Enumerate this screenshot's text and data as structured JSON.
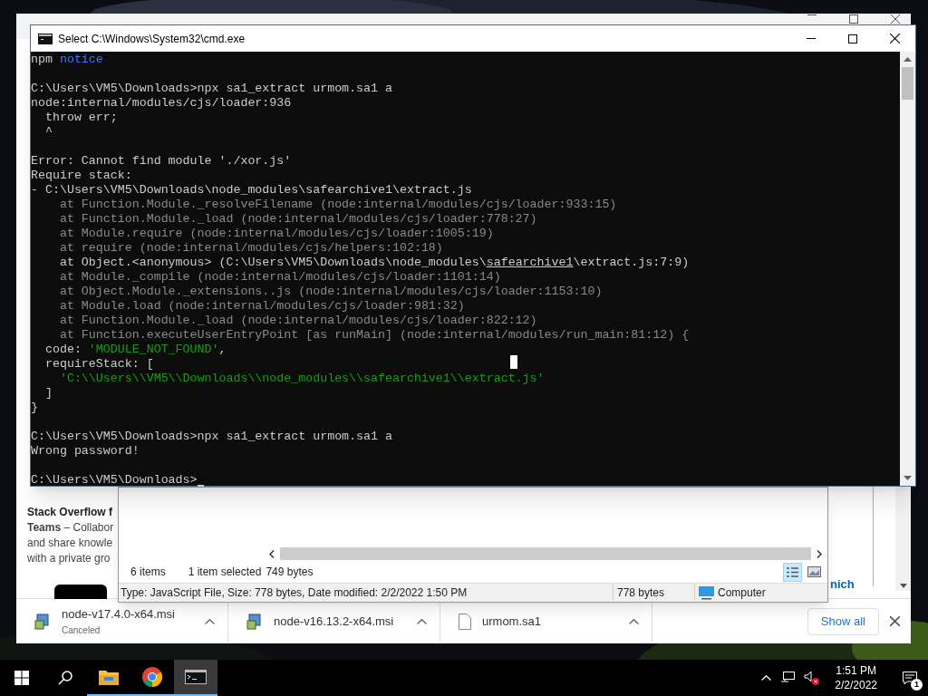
{
  "terminal": {
    "title": "Select C:\\Windows\\System32\\cmd.exe",
    "lines": [
      {
        "kind": "text",
        "segments": [
          {
            "text": "npm ",
            "kind": "plain"
          },
          {
            "text": "notice",
            "kind": "info"
          }
        ]
      },
      {
        "kind": "blank"
      },
      {
        "kind": "text",
        "segments": [
          {
            "text": "C:\\Users\\VM5\\Downloads>npx sa1_extract urmom.sa1 a",
            "kind": "plain"
          }
        ]
      },
      {
        "kind": "text",
        "segments": [
          {
            "text": "node:internal/modules/cjs/loader:936",
            "kind": "plain"
          }
        ]
      },
      {
        "kind": "text",
        "segments": [
          {
            "text": "  throw err;",
            "kind": "plain"
          }
        ]
      },
      {
        "kind": "text",
        "segments": [
          {
            "text": "  ^",
            "kind": "plain"
          }
        ]
      },
      {
        "kind": "blank"
      },
      {
        "kind": "text",
        "segments": [
          {
            "text": "Error: Cannot find module './xor.js'",
            "kind": "plain"
          }
        ]
      },
      {
        "kind": "text",
        "segments": [
          {
            "text": "Require stack:",
            "kind": "plain"
          }
        ]
      },
      {
        "kind": "text",
        "segments": [
          {
            "text": "- C:\\Users\\VM5\\Downloads\\node_modules\\safearchive1\\extract.js",
            "kind": "plain"
          }
        ]
      },
      {
        "kind": "text",
        "segments": [
          {
            "text": "    at Function.Module._resolveFilename (node:internal/modules/cjs/loader:933:15)",
            "kind": "dim"
          }
        ]
      },
      {
        "kind": "text",
        "segments": [
          {
            "text": "    at Function.Module._load (node:internal/modules/cjs/loader:778:27)",
            "kind": "dim"
          }
        ]
      },
      {
        "kind": "text",
        "segments": [
          {
            "text": "    at Module.require (node:internal/modules/cjs/loader:1005:19)",
            "kind": "dim"
          }
        ]
      },
      {
        "kind": "text",
        "segments": [
          {
            "text": "    at require (node:internal/modules/cjs/helpers:102:18)",
            "kind": "dim"
          }
        ]
      },
      {
        "kind": "text",
        "segments": [
          {
            "text": "    at Object.<anonymous> (C:\\Users\\VM5\\Downloads\\node_modules\\",
            "kind": "plain"
          },
          {
            "text": "safearchive1",
            "kind": "underlined"
          },
          {
            "text": "\\extract.js:7:9)",
            "kind": "plain"
          }
        ]
      },
      {
        "kind": "text",
        "segments": [
          {
            "text": "    at Module._compile (node:internal/modules/cjs/loader:1101:14)",
            "kind": "dim"
          }
        ]
      },
      {
        "kind": "text",
        "segments": [
          {
            "text": "    at Object.Module._extensions..js (node:internal/modules/cjs/loader:1153:10)",
            "kind": "dim"
          }
        ]
      },
      {
        "kind": "text",
        "segments": [
          {
            "text": "    at Module.load (node:internal/modules/cjs/loader:981:32)",
            "kind": "dim"
          }
        ]
      },
      {
        "kind": "text",
        "segments": [
          {
            "text": "    at Function.Module._load (node:internal/modules/cjs/loader:822:12)",
            "kind": "dim"
          }
        ]
      },
      {
        "kind": "text",
        "segments": [
          {
            "text": "    at Function.executeUserEntryPoint [as runMain] (node:internal/modules/run_main:81:12) {",
            "kind": "dim"
          }
        ]
      },
      {
        "kind": "text",
        "segments": [
          {
            "text": "  code: ",
            "kind": "plain"
          },
          {
            "text": "'MODULE_NOT_FOUND'",
            "kind": "string"
          },
          {
            "text": ",",
            "kind": "plain"
          }
        ]
      },
      {
        "kind": "text",
        "segments": [
          {
            "text": "  requireStack: [",
            "kind": "plain"
          }
        ]
      },
      {
        "kind": "text",
        "segments": [
          {
            "text": "    'C:\\\\Users\\\\VM5\\\\Downloads\\\\node_modules\\\\safearchive1\\\\extract.js'",
            "kind": "string"
          }
        ]
      },
      {
        "kind": "text",
        "segments": [
          {
            "text": "  ]",
            "kind": "plain"
          }
        ]
      },
      {
        "kind": "text",
        "segments": [
          {
            "text": "}",
            "kind": "plain"
          }
        ]
      },
      {
        "kind": "blank"
      },
      {
        "kind": "text",
        "segments": [
          {
            "text": "C:\\Users\\VM5\\Downloads>npx sa1_extract urmom.sa1 a",
            "kind": "plain"
          }
        ]
      },
      {
        "kind": "text",
        "segments": [
          {
            "text": "Wrong password!",
            "kind": "plain"
          }
        ]
      },
      {
        "kind": "blank"
      },
      {
        "kind": "prompt",
        "segments": [
          {
            "text": "C:\\Users\\VM5\\Downloads>",
            "kind": "plain"
          }
        ]
      }
    ]
  },
  "browser": {
    "page_text": [
      {
        "text": "Stack Overflow f",
        "bold": true
      },
      {
        "text": "**Teams** – Collabor",
        "bold": false
      },
      {
        "text": "and share knowle",
        "bold": false
      },
      {
        "text": "with a private gro",
        "bold": false
      }
    ],
    "link": "nich",
    "downloads": [
      {
        "name": "node-v17.4.0-x64.msi",
        "status": "Canceled",
        "kind": "installer"
      },
      {
        "name": "node-v16.13.2-x64.msi",
        "kind": "installer"
      },
      {
        "name": "urmom.sa1",
        "kind": "file"
      }
    ],
    "show_all": "Show all"
  },
  "explorer": {
    "item_count": "6 items",
    "selection": "1 item selected",
    "selection_size": "749 bytes",
    "views": [
      {
        "kind": "details",
        "selected": true
      },
      {
        "kind": "preview",
        "selected": false
      }
    ],
    "details": "Type: JavaScript File, Size: 778 bytes, Date modified: 2/2/2022 1:50 PM",
    "size": "778 bytes",
    "location": "Computer"
  },
  "taskbar": {
    "apps": [
      {
        "kind": "explorer",
        "selected": false
      },
      {
        "kind": "chrome",
        "selected": false
      },
      {
        "kind": "terminal",
        "selected": true
      }
    ],
    "time": "1:51 PM",
    "date": "2/2/2022",
    "notifications": "1"
  }
}
